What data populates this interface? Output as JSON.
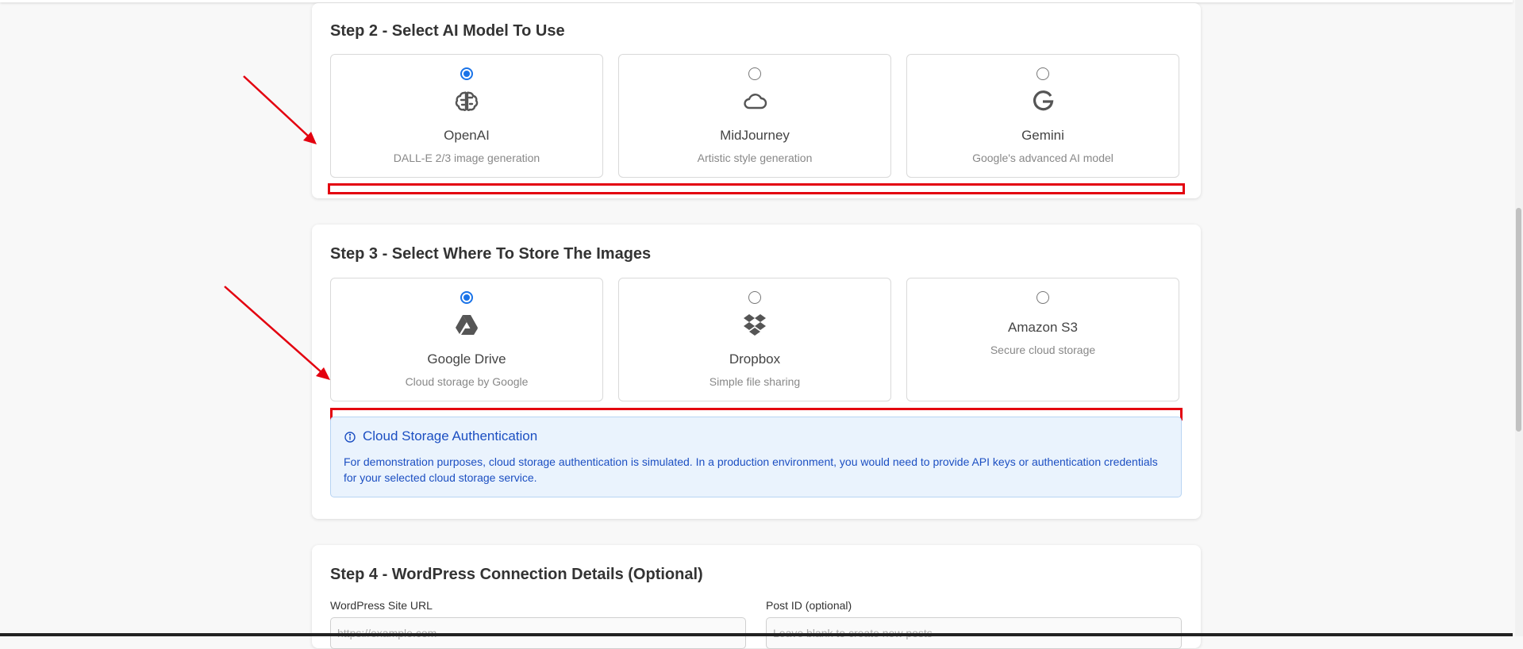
{
  "step2": {
    "title": "Step 2 - Select AI Model To Use",
    "options": [
      {
        "title": "OpenAI",
        "description": "DALL-E 2/3 image generation",
        "icon": "brain-icon",
        "checked": true
      },
      {
        "title": "MidJourney",
        "description": "Artistic style generation",
        "icon": "cloud-icon",
        "checked": false
      },
      {
        "title": "Gemini",
        "description": "Google's advanced AI model",
        "icon": "google-g-icon",
        "checked": false
      }
    ]
  },
  "step3": {
    "title": "Step 3 - Select Where To Store The Images",
    "options": [
      {
        "title": "Google Drive",
        "description": "Cloud storage by Google",
        "icon": "google-drive-icon",
        "checked": true
      },
      {
        "title": "Dropbox",
        "description": "Simple file sharing",
        "icon": "dropbox-icon",
        "checked": false
      },
      {
        "title": "Amazon S3",
        "description": "Secure cloud storage",
        "icon": "",
        "checked": false
      }
    ],
    "alert": {
      "title": "Cloud Storage Authentication",
      "icon": "info-icon",
      "body": "For demonstration purposes, cloud storage authentication is simulated. In a production environment, you would need to provide API keys or authentication credentials for your selected cloud storage service."
    }
  },
  "step4": {
    "title": "Step 4 - WordPress Connection Details (Optional)",
    "site_url_label": "WordPress Site URL",
    "site_url_placeholder": "https://example.com",
    "post_id_label": "Post ID (optional)",
    "post_id_placeholder": "Leave blank to create new posts"
  },
  "colors": {
    "accent": "#1a73e8",
    "annotation_red": "#e3000f",
    "alert_text": "#1c4fc2",
    "alert_bg": "#eaf3fd"
  }
}
